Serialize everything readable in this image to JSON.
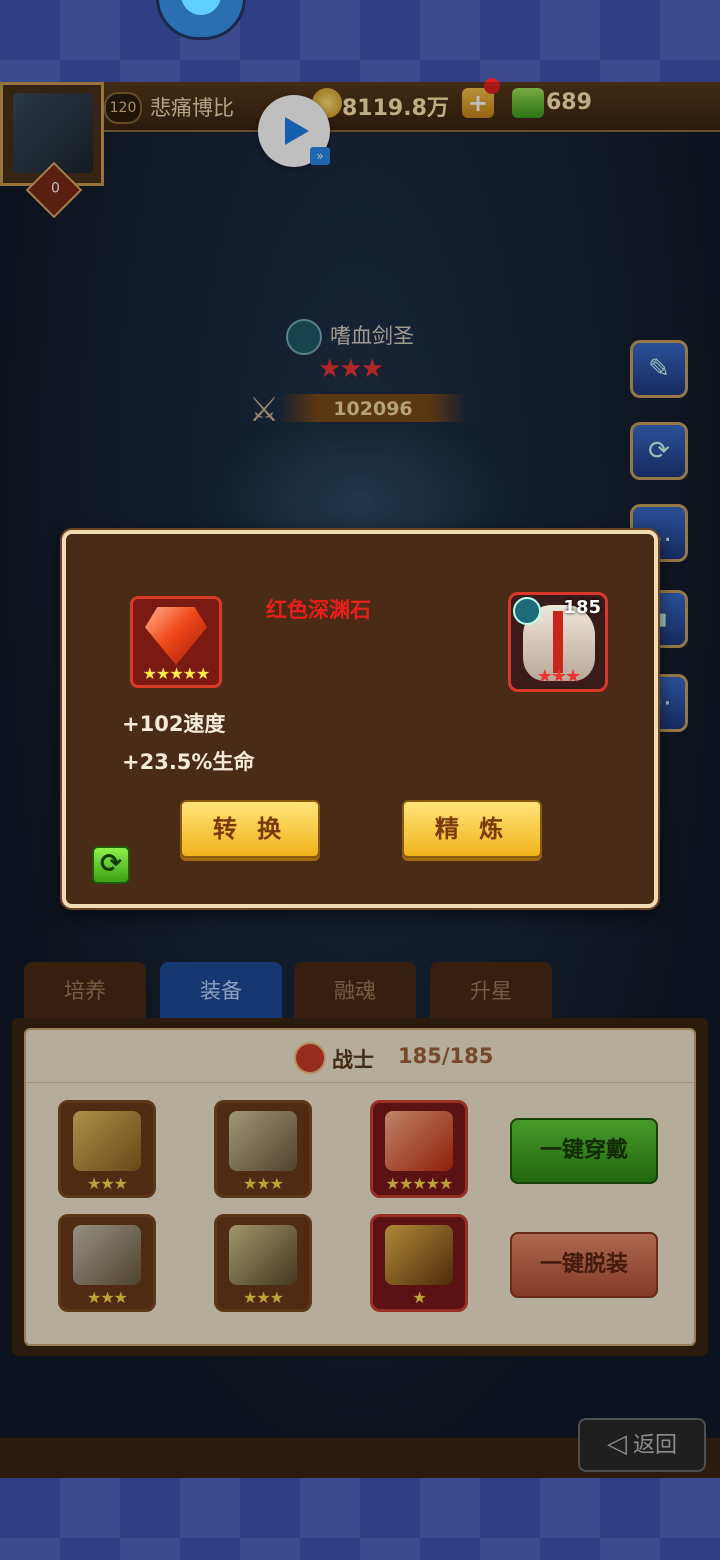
{
  "player": {
    "level": "120",
    "name": "悲痛博比",
    "gold": "8119.8万",
    "gems": "689",
    "avatar_badge": "0"
  },
  "hero": {
    "name": "嗜血剑圣",
    "stars": "★★★",
    "power": "102096"
  },
  "tabs": [
    {
      "label": "培养"
    },
    {
      "label": "装备"
    },
    {
      "label": "融魂"
    },
    {
      "label": "升星"
    }
  ],
  "equipment_panel": {
    "class_label": "战士",
    "class_count": "185/185",
    "equip_all_label": "一键穿戴",
    "unequip_all_label": "一键脱装",
    "slots": [
      {
        "stars": "★★★"
      },
      {
        "stars": "★★★"
      },
      {
        "stars": "★★★★★"
      },
      {
        "stars": "★★★"
      },
      {
        "stars": "★★★"
      },
      {
        "stars": "★"
      }
    ]
  },
  "dialog": {
    "item_name": "红色深渊石",
    "item_stars": "★★★★★",
    "hero_level": "185",
    "hero_stars": "★★★",
    "stat1": "+102速度",
    "stat2": "+23.5%生命",
    "convert_label": "转 换",
    "refine_label": "精 炼"
  },
  "back_label": "返回",
  "icons": {
    "edit": "pencil-icon",
    "swap": "refresh-icon",
    "chat": "chat-icon",
    "share": "share-icon"
  }
}
